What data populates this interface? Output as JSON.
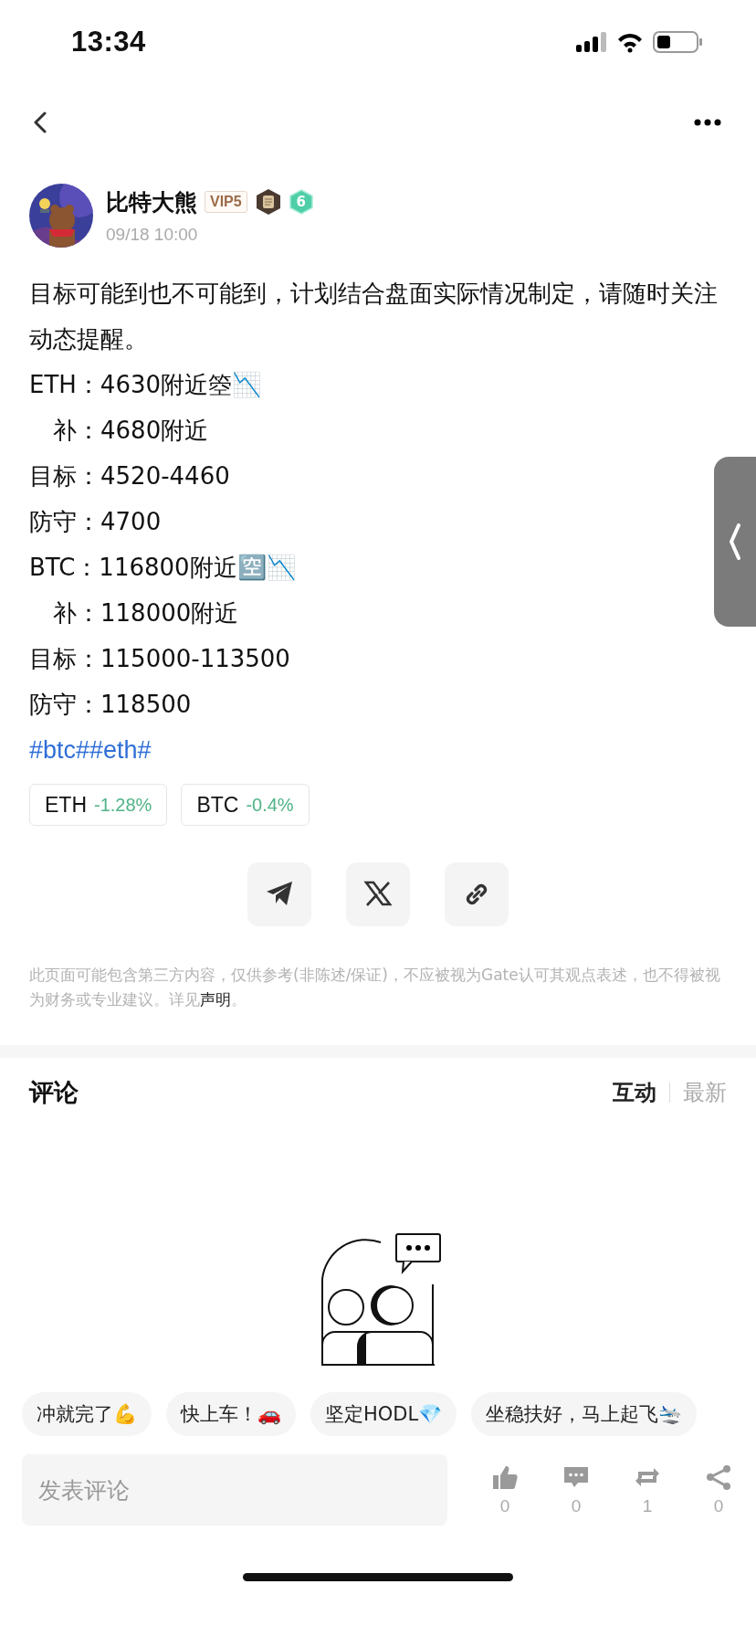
{
  "status_bar": {
    "time": "13:34"
  },
  "post": {
    "author": "比特大熊",
    "vip": "VIP5",
    "level": "6",
    "date": "09/18 10:00",
    "intro": "目标可能到也不可能到，计划结合盘面实际情况制定，请随时关注动态提醒。",
    "lines": [
      {
        "kind": "main",
        "text": "ETH：4630附近箜📉"
      },
      {
        "kind": "sub",
        "text": "补：4680附近"
      },
      {
        "kind": "main",
        "text": "目标：4520-4460"
      },
      {
        "kind": "main",
        "text": "防守：4700"
      },
      {
        "kind": "main",
        "text": "BTC：116800附近🈳📉"
      },
      {
        "kind": "sub",
        "text": "补：118000附近"
      },
      {
        "kind": "main",
        "text": "目标：115000-113500"
      },
      {
        "kind": "main",
        "text": "防守：118500"
      }
    ],
    "hashtags": "#btc##eth#",
    "coins": [
      {
        "symbol": "ETH",
        "change": "-1.28%"
      },
      {
        "symbol": "BTC",
        "change": "-0.4%"
      }
    ],
    "share": [
      {
        "kind": "telegram"
      },
      {
        "kind": "x"
      },
      {
        "kind": "link"
      }
    ],
    "disclaimer": {
      "text": "此页面可能包含第三方内容，仅供参考(非陈述/保证)，不应被视为Gate认可其观点表述，也不得被视为财务或专业建议。详见",
      "link": "声明",
      "tail": "。"
    }
  },
  "comments": {
    "title": "评论",
    "sort": [
      {
        "label": "互动",
        "selected": true
      },
      {
        "label": "最新",
        "selected": false
      }
    ],
    "quick_replies": [
      "冲就完了💪",
      "快上车！🚗",
      "坚定HODL💎",
      "坐稳扶好，马上起飞🛬"
    ],
    "input": {
      "placeholder": "发表评论"
    },
    "actions": [
      {
        "kind": "like",
        "count": "0"
      },
      {
        "kind": "comment",
        "count": "0"
      },
      {
        "kind": "repost",
        "count": "1"
      },
      {
        "kind": "share",
        "count": "0"
      }
    ]
  }
}
